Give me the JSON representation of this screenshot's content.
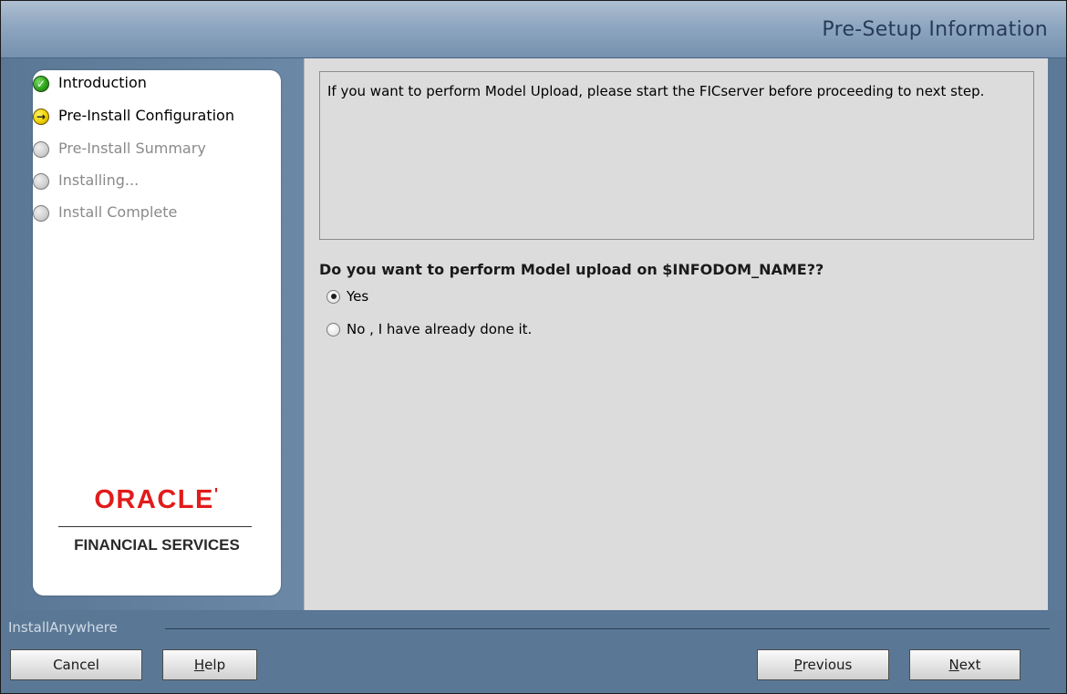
{
  "header": {
    "title": "Pre-Setup Information"
  },
  "steps": [
    {
      "label": "Introduction",
      "state": "done",
      "icon": "check-icon"
    },
    {
      "label": "Pre-Install Configuration",
      "state": "current",
      "icon": "arrow-right-icon"
    },
    {
      "label": "Pre-Install Summary",
      "state": "pending",
      "icon": "circle-icon"
    },
    {
      "label": "Installing...",
      "state": "pending",
      "icon": "circle-icon"
    },
    {
      "label": "Install Complete",
      "state": "pending",
      "icon": "circle-icon"
    }
  ],
  "logo": {
    "brand": "ORACLE",
    "trademark": "'",
    "tagline": "FINANCIAL SERVICES"
  },
  "content": {
    "message": "If you want to perform Model Upload, please start the FICserver before proceeding to next step.",
    "question": "Do you want to perform Model upload on $INFODOM_NAME??",
    "options": [
      {
        "label": "Yes",
        "selected": true
      },
      {
        "label": "No , I have already done it.",
        "selected": false
      }
    ]
  },
  "footer": {
    "brand": "InstallAnywhere",
    "buttons": {
      "cancel": {
        "label": "Cancel"
      },
      "help": {
        "mnemonic": "H",
        "rest": "elp"
      },
      "previous": {
        "mnemonic": "P",
        "rest": "revious"
      },
      "next": {
        "mnemonic": "N",
        "rest": "ext"
      }
    }
  },
  "colors": {
    "frame": "#5f7fa0",
    "content_bg": "#dcdcdc",
    "header_text": "#273b57",
    "oracle_red": "#e21b1b",
    "step_done": "#2fa31c",
    "step_current": "#f0d000",
    "step_pending": "#a8a8a8"
  }
}
